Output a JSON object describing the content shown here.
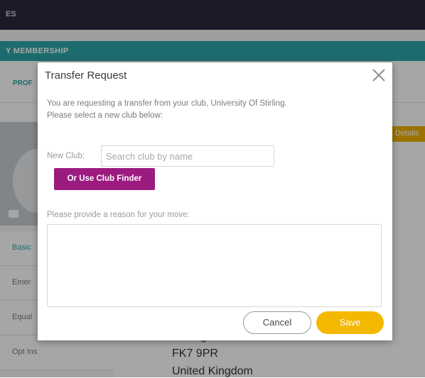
{
  "background": {
    "topbar_text": "ES",
    "section_title": "Y MEMBERSHIP",
    "tab_fragment": "PROF",
    "detail_button": "Details",
    "nav_items": [
      {
        "label": "Basic"
      },
      {
        "label": "Emer"
      },
      {
        "label": "Equal"
      },
      {
        "label": "Opt Ins"
      }
    ],
    "address_lines": [
      "Stirling",
      "FK7 9PR",
      "United Kingdom"
    ]
  },
  "modal": {
    "title": "Transfer Request",
    "message_line1": "You are requesting a transfer from your club, University Of Stirling.",
    "message_line2": "Please select a new club below:",
    "new_club_label": "New Club:",
    "search_placeholder": "Search club by name",
    "search_value": "",
    "club_finder_label": "Or Use Club Finder",
    "reason_label": "Please provide a reason for your move:",
    "reason_value": "",
    "cancel_label": "Cancel",
    "save_label": "Save"
  },
  "icons": {
    "close": "close-icon",
    "camera": "camera-icon"
  },
  "colors": {
    "topbar": "#2b2840",
    "teal": "#2da6a8",
    "finder_button": "#9b1b7f",
    "save_button": "#f5b800"
  }
}
